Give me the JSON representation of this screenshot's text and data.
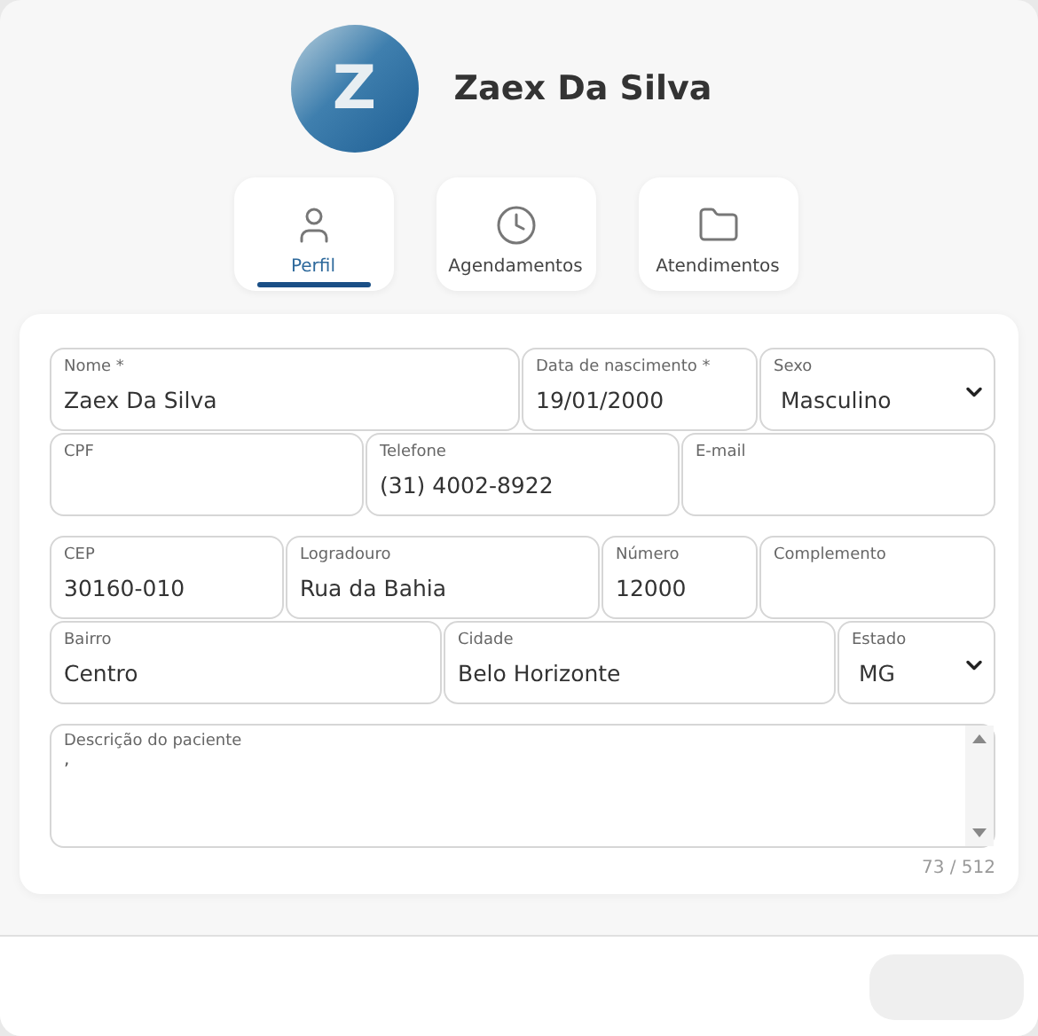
{
  "profile": {
    "initial": "Z",
    "name": "Zaex Da Silva"
  },
  "tabs": [
    {
      "label": "Perfil",
      "selected": true
    },
    {
      "label": "Agendamentos",
      "selected": false
    },
    {
      "label": "Atendimentos",
      "selected": false
    }
  ],
  "form_rows": [
    {
      "fields": [
        {
          "kind": "text",
          "label": "Nome *",
          "value": "Zaex Da Silva"
        },
        {
          "kind": "text",
          "label": "Data de nascimento *",
          "value": "19/01/2000"
        },
        {
          "kind": "select",
          "label": "Sexo",
          "value": "Masculino"
        }
      ]
    },
    {
      "fields": [
        {
          "kind": "text",
          "label": "CPF"
        },
        {
          "kind": "text",
          "label": "Telefone",
          "value": "(31) 4002-8922"
        },
        {
          "kind": "text",
          "label": "E-mail"
        }
      ]
    },
    {
      "fields": [
        {
          "kind": "text",
          "label": "CEP",
          "value": "30160-010"
        },
        {
          "kind": "text",
          "label": "Logradouro",
          "value": "Rua da Bahia"
        },
        {
          "kind": "text",
          "label": "Número",
          "value": "12000"
        },
        {
          "kind": "text",
          "label": "Complemento"
        }
      ]
    },
    {
      "fields": [
        {
          "kind": "text",
          "label": "Bairro",
          "value": "Centro"
        },
        {
          "kind": "text",
          "label": "Cidade",
          "value": "Belo Horizonte"
        },
        {
          "kind": "select",
          "label": "Estado",
          "value": "MG"
        }
      ]
    }
  ],
  "description": {
    "label": "Descrição do paciente",
    "value": ",",
    "counter": "73 / 512"
  }
}
